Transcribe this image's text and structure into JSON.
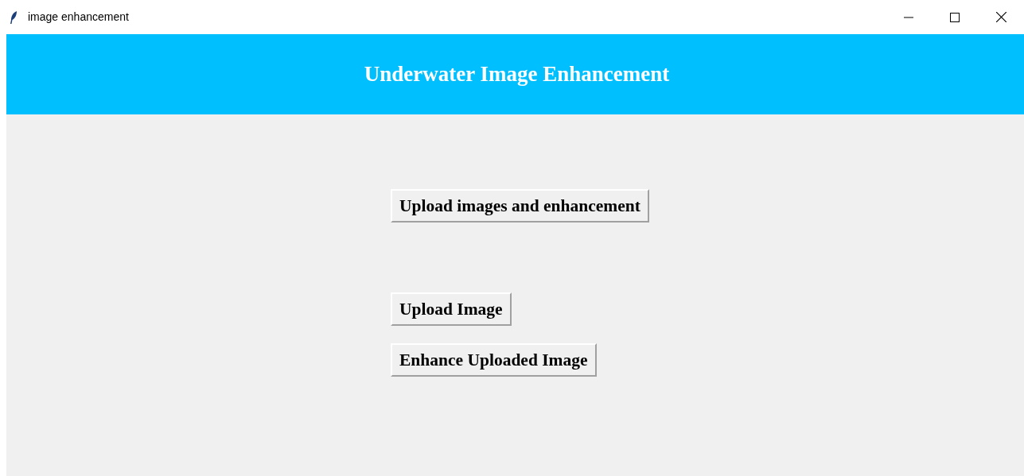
{
  "window": {
    "title": "image enhancement"
  },
  "header": {
    "title": "Underwater Image Enhancement"
  },
  "buttons": [
    {
      "label": "Upload images and enhancement"
    },
    {
      "label": "Upload Image"
    },
    {
      "label": "Enhance Uploaded Image"
    }
  ]
}
